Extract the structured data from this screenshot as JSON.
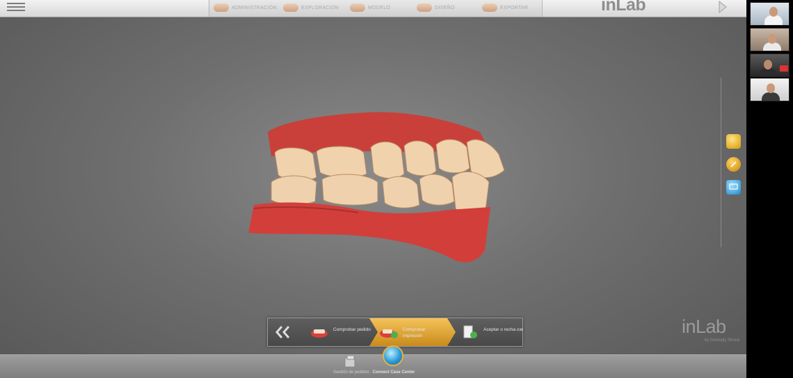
{
  "header": {
    "brand": "inLab",
    "phases": [
      {
        "label": "ADMINISTRACIÓN",
        "state": "inactive"
      },
      {
        "label": "EXPLORACIÓN",
        "state": "inactive"
      },
      {
        "label": "MODELO",
        "state": "inactive"
      },
      {
        "label": "DISEÑO",
        "state": "inactive"
      },
      {
        "label": "EXPORTAR",
        "state": "inactive"
      }
    ]
  },
  "right_toolbar": {
    "icons": [
      "shield-icon",
      "wand-icon",
      "screen-icon"
    ]
  },
  "watermark": {
    "brand": "inLab",
    "sub": "by Dentsply Sirona"
  },
  "step_bar": {
    "steps": [
      {
        "label": "Comprobar pedido",
        "active": false
      },
      {
        "label": "Comprobar impresión",
        "active": true
      },
      {
        "label": "Aceptar o recha-zar",
        "active": false
      }
    ]
  },
  "bottom_bar": {
    "items": [
      {
        "label": "Gestión de pedidos",
        "active": false
      },
      {
        "label": "Connect Case Center",
        "active": true
      }
    ]
  },
  "colors": {
    "accent": "#e8b23a",
    "viewport": "#6f6f6f",
    "gum": "#d9403a",
    "tooth": "#f0d7b8"
  }
}
